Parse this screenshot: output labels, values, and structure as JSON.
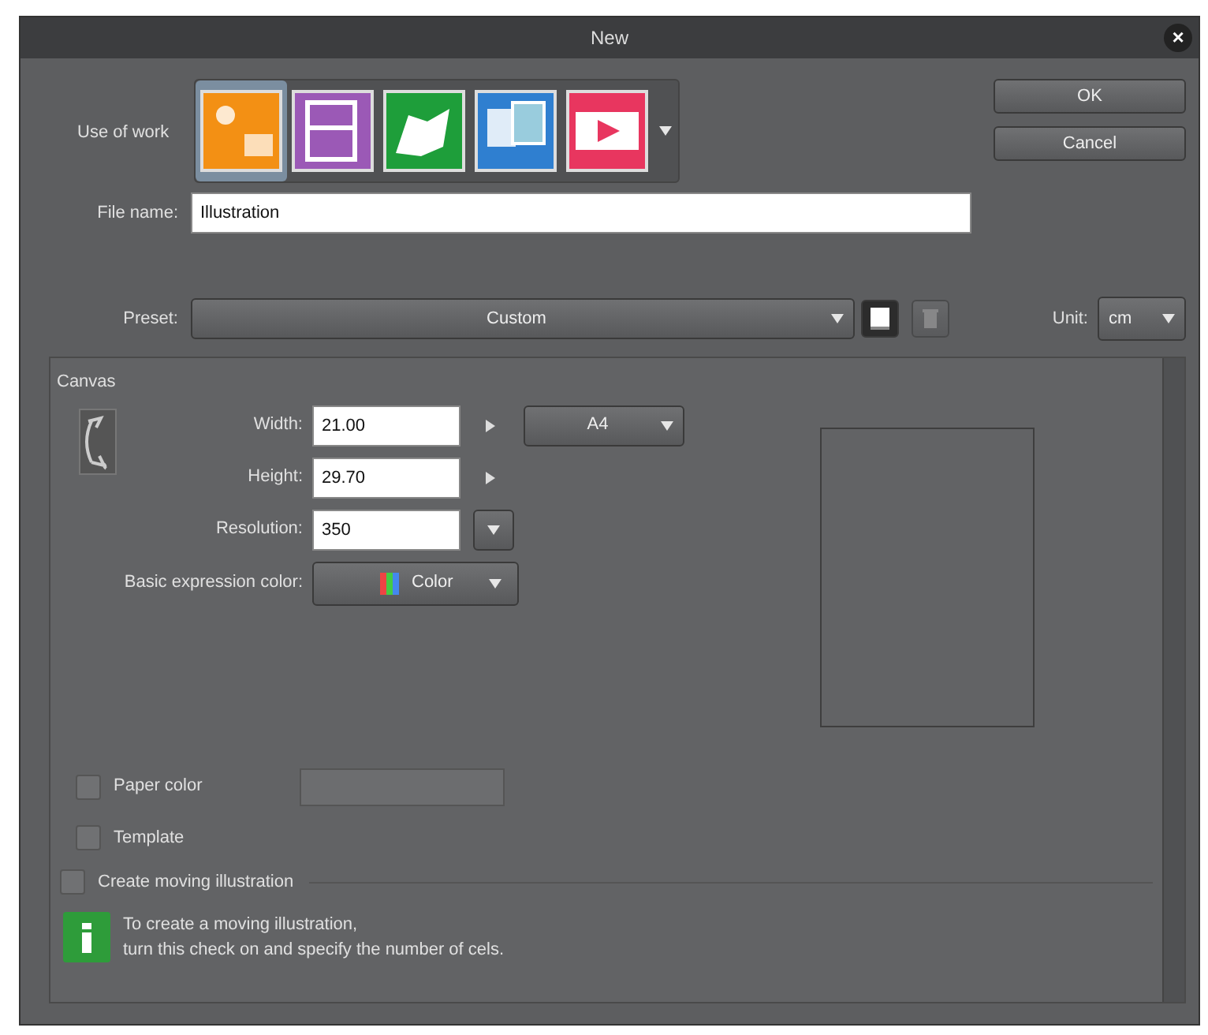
{
  "window": {
    "title": "New",
    "close": "×"
  },
  "use_of_work": {
    "label": "Use of work",
    "options": [
      {
        "kind": "illustration",
        "color": "#f39014",
        "selected": true
      },
      {
        "kind": "comic",
        "color": "#9b59b6",
        "selected": false
      },
      {
        "kind": "book",
        "color": "#1e9e3a",
        "selected": false
      },
      {
        "kind": "cards",
        "color": "#2f7fd0",
        "selected": false
      },
      {
        "kind": "animation",
        "color": "#e8365f",
        "selected": false
      }
    ]
  },
  "buttons": [
    "OK",
    "Cancel"
  ],
  "file_name": {
    "label": "File name:",
    "value": "Illustration"
  },
  "preset": {
    "label": "Preset:",
    "value": "Custom"
  },
  "unit": {
    "label": "Unit:",
    "value": "cm"
  },
  "canvas": {
    "title": "Canvas",
    "fields": [
      {
        "label": "Width:",
        "value": "21.00",
        "kind": "arrow"
      },
      {
        "label": "Height:",
        "value": "29.70",
        "kind": "arrow"
      },
      {
        "label": "Resolution:",
        "value": "350",
        "kind": "dropdown"
      }
    ],
    "size_preset": "A4",
    "expression_color": {
      "label": "Basic expression color:",
      "value": "Color"
    },
    "paper_color": {
      "label": "Paper color",
      "checked": false
    },
    "template": {
      "label": "Template",
      "checked": false
    }
  },
  "moving": {
    "label": "Create moving illustration",
    "checked": false,
    "info_lines": [
      "To create a moving illustration,",
      "turn this check on and specify the number of cels."
    ]
  }
}
